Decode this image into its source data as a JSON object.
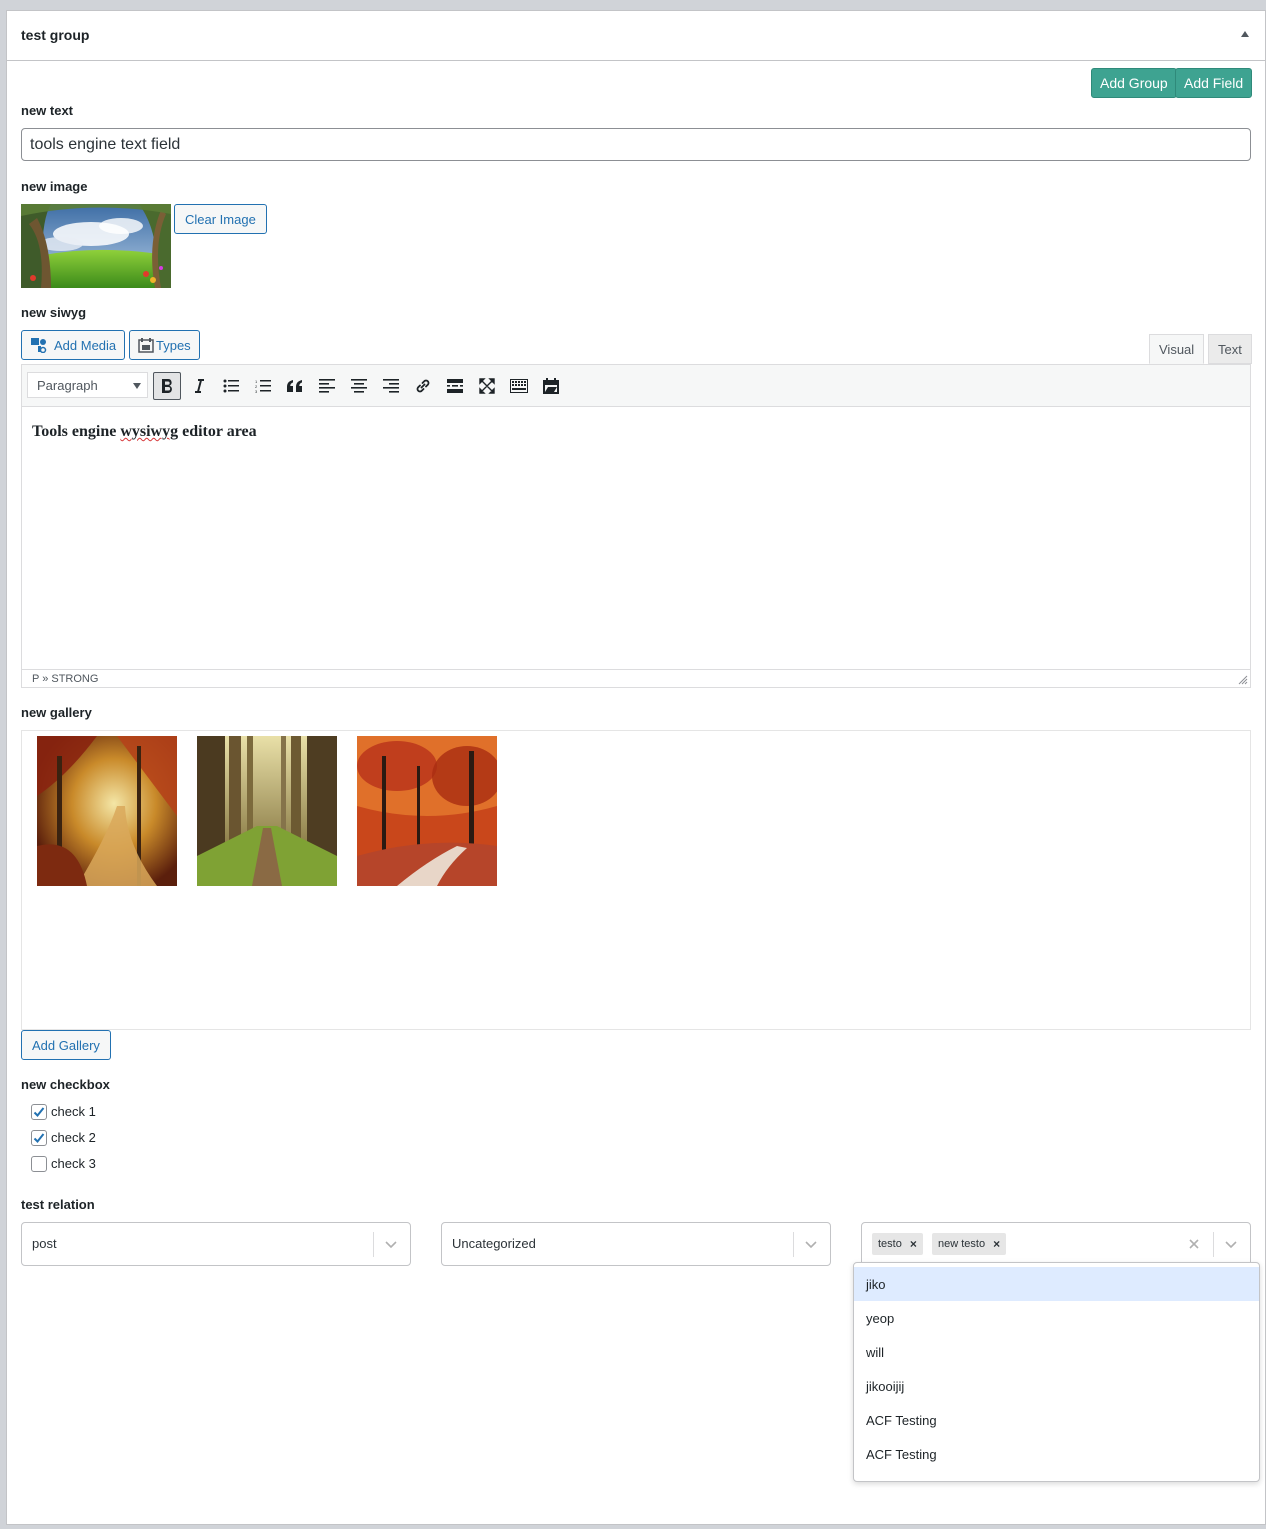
{
  "panel": {
    "title": "test group"
  },
  "actions": {
    "add_group": "Add Group",
    "add_field": "Add Field"
  },
  "fields": {
    "text": {
      "label": "new text",
      "value": "tools engine text field"
    },
    "image": {
      "label": "new image",
      "clear_label": "Clear Image"
    },
    "wysiwyg": {
      "label": "new siwyg",
      "add_media": "Add Media",
      "types": "Types",
      "tab_visual": "Visual",
      "tab_text": "Text",
      "format": "Paragraph",
      "content_a": "Tools engine ",
      "content_b": "wysiwyg",
      "content_c": " editor area",
      "status_path": "P » STRONG"
    },
    "gallery": {
      "label": "new gallery",
      "add_label": "Add Gallery"
    },
    "checkbox": {
      "label": "new checkbox",
      "options": [
        {
          "label": "check 1",
          "checked": true
        },
        {
          "label": "check 2",
          "checked": true
        },
        {
          "label": "check 3",
          "checked": false
        }
      ]
    },
    "relation": {
      "label": "test relation",
      "post_type": "post",
      "category": "Uncategorized",
      "tags": [
        "testo",
        "new testo"
      ],
      "options": [
        "jiko",
        "yeop",
        "will",
        "jikooijij",
        "ACF Testing",
        "ACF Testing"
      ]
    }
  },
  "colors": {
    "accent": "#3ea391",
    "link": "#2271b1",
    "highlight": "#deebff"
  }
}
